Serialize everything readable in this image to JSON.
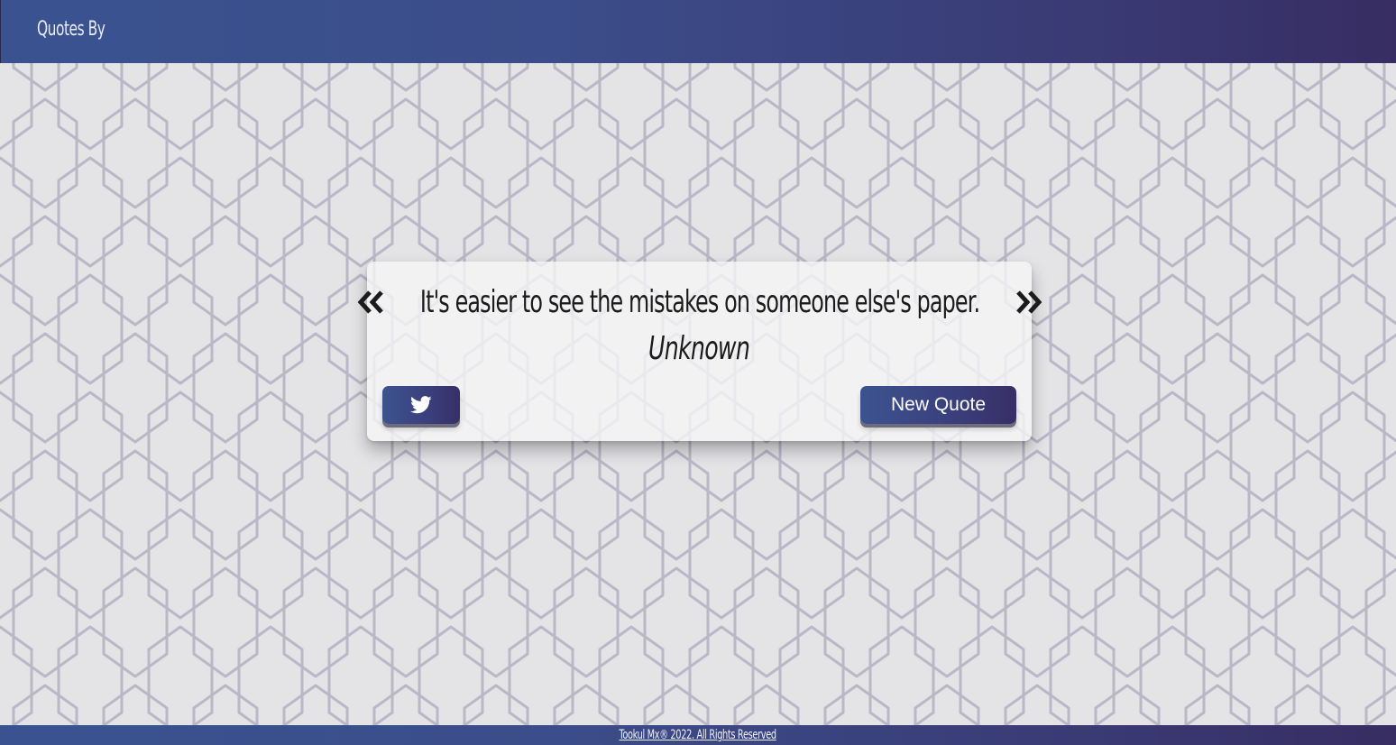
{
  "header": {
    "title": "Quotes By"
  },
  "quote": {
    "text": "It's easier to see the mistakes on someone else's paper.",
    "author": "Unknown"
  },
  "actions": {
    "tweet_icon": "twitter-icon",
    "new_quote_label": "New Quote"
  },
  "footer": {
    "text": "Tookul Mx® 2022. All Rights Reserved"
  },
  "colors": {
    "header_start": "#3a5390",
    "header_end": "#372d63",
    "background": "#e4e3e6",
    "pattern_stroke": "#b9b6c6"
  }
}
